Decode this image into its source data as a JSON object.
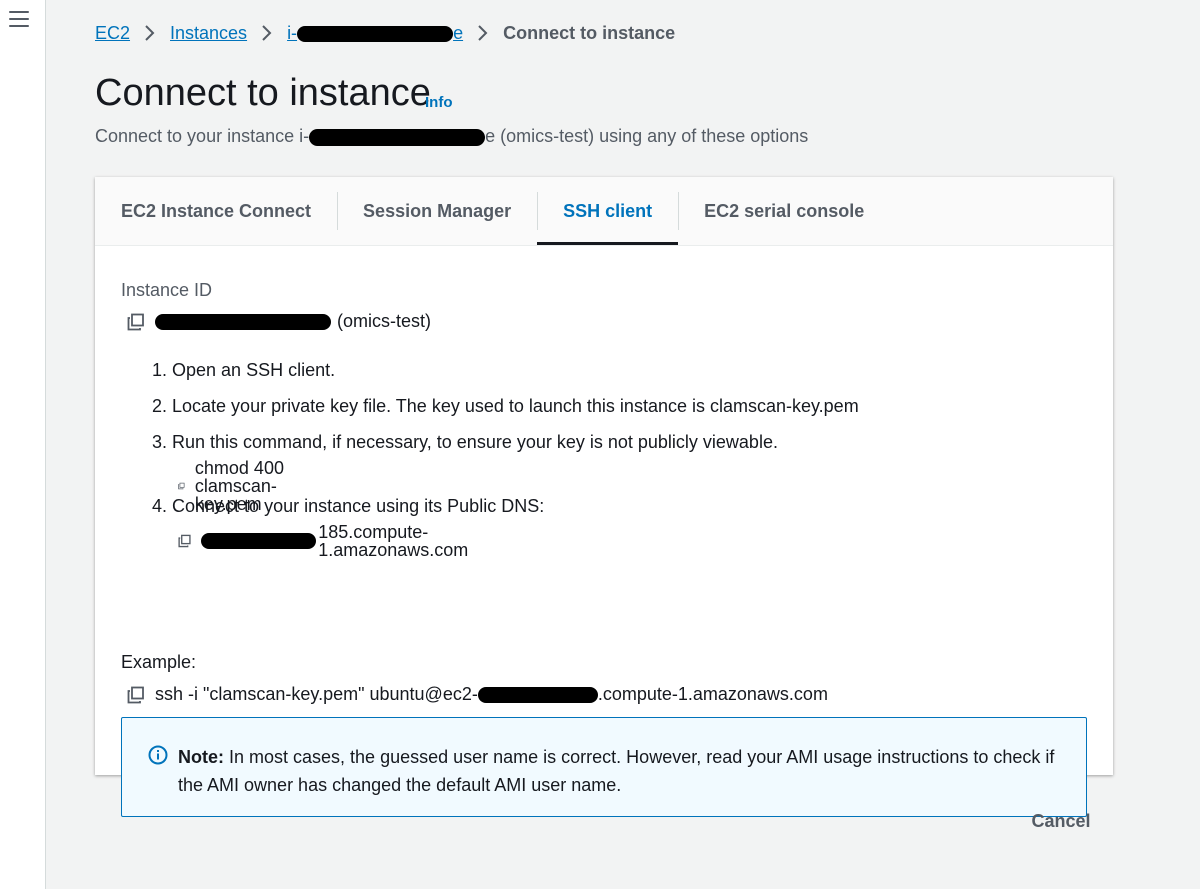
{
  "breadcrumb": {
    "ec2": "EC2",
    "instances": "Instances",
    "instance_prefix": "i-",
    "instance_suffix": "e",
    "current": "Connect to instance"
  },
  "header": {
    "title": "Connect to instance",
    "info": "Info",
    "subtitle_prefix": "Connect to your instance i-",
    "subtitle_suffix": "e (omics-test) using any of these options"
  },
  "tabs": [
    {
      "label": "EC2 Instance Connect",
      "active": false
    },
    {
      "label": "Session Manager",
      "active": false
    },
    {
      "label": "SSH client",
      "active": true
    },
    {
      "label": "EC2 serial console",
      "active": false
    }
  ],
  "ssh": {
    "instance_label": "Instance ID",
    "instance_name": "(omics-test)",
    "step1": "1. Open an SSH client.",
    "step2": "2. Locate your private key file. The key used to launch this instance is clamscan-key.pem",
    "step3": "3. Run this command, if necessary, to ensure your key is not publicly viewable.",
    "chmod_cmd": "chmod 400 clamscan-key.pem",
    "step4": "4. Connect to your instance using its Public DNS:",
    "dns_suffix": "185.compute-1.amazonaws.com",
    "example_label": "Example:",
    "example_prefix": "ssh -i \"clamscan-key.pem\" ubuntu@ec2-",
    "example_suffix": ".compute-1.amazonaws.com"
  },
  "note": {
    "bold": "Note:",
    "text": " In most cases, the guessed user name is correct. However, read your AMI usage instructions to check if the AMI owner has changed the default AMI user name."
  },
  "footer": {
    "cancel": "Cancel"
  },
  "colors": {
    "link": "#0073bb",
    "text": "#16191f",
    "muted": "#545b64",
    "note_bg": "#f1faff",
    "page_bg": "#f2f3f3"
  }
}
